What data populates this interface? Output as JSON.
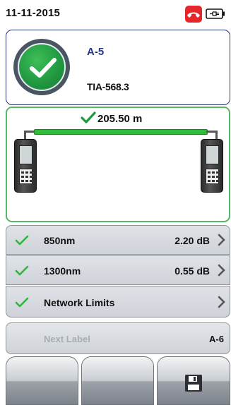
{
  "status": {
    "date": "11-11-2015",
    "phone_icon": "phone-hangup-icon",
    "battery_icon": "battery-plug-icon"
  },
  "result": {
    "status_icon": "pass-check-icon",
    "label": "A-5",
    "standard": "TIA-568.3"
  },
  "link": {
    "length": "205.50 m",
    "length_status_icon": "check-icon",
    "colors": {
      "pass": "#2bbf36",
      "border": "#55b963"
    }
  },
  "measurements": [
    {
      "status_icon": "check-icon",
      "label": "850nm",
      "value": "2.20 dB"
    },
    {
      "status_icon": "check-icon",
      "label": "1300nm",
      "value": "0.55 dB"
    },
    {
      "status_icon": "check-icon",
      "label": "Network Limits",
      "value": ""
    }
  ],
  "next_label": {
    "label": "Next Label",
    "value": "A-6"
  },
  "softkeys": [
    {
      "label": ""
    },
    {
      "label": ""
    },
    {
      "label": "",
      "icon": "save-icon"
    }
  ],
  "colors": {
    "accent": "#23398a",
    "fail_badge": "#e5262b"
  }
}
